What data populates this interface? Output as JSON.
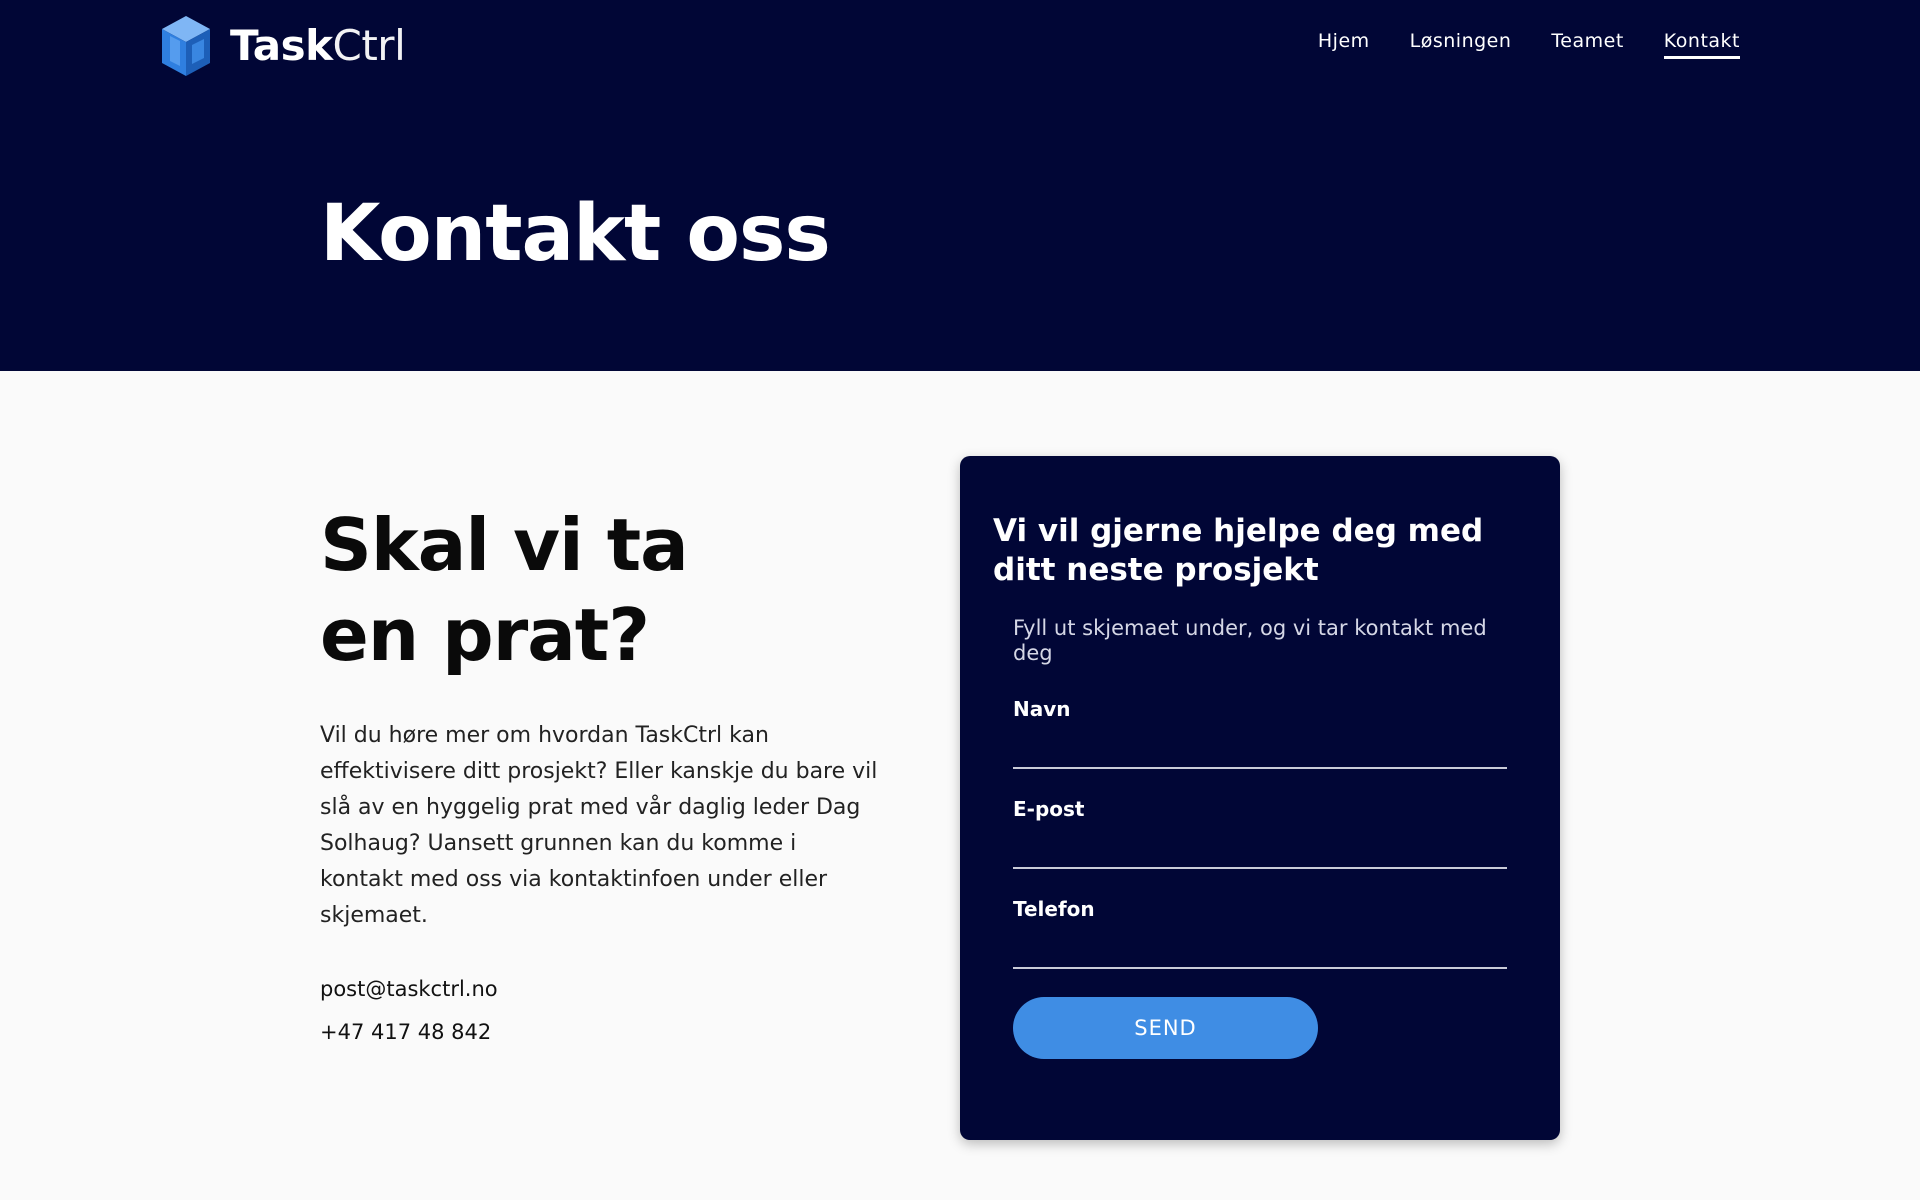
{
  "header": {
    "logo_text_bold": "Task",
    "logo_text_light": "Ctrl",
    "logo_icon": "cube-icon",
    "nav": [
      {
        "label": "Hjem",
        "active": false
      },
      {
        "label": "Løsningen",
        "active": false
      },
      {
        "label": "Teamet",
        "active": false
      },
      {
        "label": "Kontakt",
        "active": true
      }
    ]
  },
  "hero": {
    "title": "Kontakt oss"
  },
  "intro": {
    "title_line1": "Skal vi ta",
    "title_line2": "en prat?",
    "text": "Vil du høre mer om hvordan TaskCtrl kan effektivisere ditt prosjekt? Eller kanskje du bare vil slå av en hyggelig prat med vår daglig leder Dag Solhaug? Uansett grunnen kan du komme i kontakt med oss via kontaktinfoen under eller skjemaet.",
    "email": "post@taskctrl.no",
    "phone": "+47 417 48 842"
  },
  "form": {
    "title": "Vi vil gjerne hjelpe deg med ditt neste prosjekt",
    "subtitle": "Fyll ut skjemaet under, og vi tar kontakt med deg",
    "fields": [
      {
        "label": "Navn",
        "value": ""
      },
      {
        "label": "E-post",
        "value": ""
      },
      {
        "label": "Telefon",
        "value": ""
      }
    ],
    "submit_label": "SEND"
  },
  "colors": {
    "navy": "#010636",
    "accent_blue": "#3f8de4",
    "page_bg": "#fafafa"
  }
}
